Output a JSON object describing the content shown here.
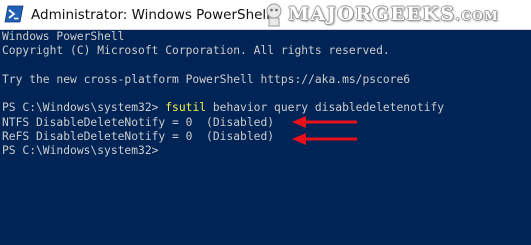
{
  "window": {
    "title": "Administrator: Windows PowerShell",
    "background": "#012456",
    "text_color": "#CCCCCC",
    "command_color": "#F5F542",
    "annotation_arrow_color": "#E8101A"
  },
  "watermark": {
    "text": "MAJORGEEKS",
    "suffix": ".COM"
  },
  "console": {
    "lines": [
      "Windows PowerShell",
      "Copyright (C) Microsoft Corporation. All rights reserved.",
      "",
      "Try the new cross-platform PowerShell https://aka.ms/pscore6",
      ""
    ],
    "prompt": "PS C:\\Windows\\system32> ",
    "command_name": "fsutil",
    "command_args": " behavior query disabledeletenotify",
    "output_ntfs": "NTFS DisableDeleteNotify = 0  (Disabled)",
    "output_refs": "ReFS DisableDeleteNotify = 0  (Disabled)",
    "final_prompt": "PS C:\\Windows\\system32>"
  },
  "icons": {
    "app": "powershell-icon",
    "annotation": "red-arrow-icon"
  }
}
